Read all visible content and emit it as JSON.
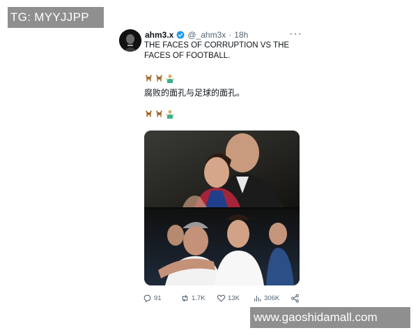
{
  "watermark_top": "TG: MYYJJPP",
  "watermark_bottom": "www.gaoshidamall.com",
  "tweet": {
    "display_name": "ahm3.x",
    "handle": "@_ahm3x",
    "separator": "·",
    "time": "18h",
    "text_en": "THE FACES OF CORRUPTION VS THE FACES OF FOOTBALL.",
    "text_zh": "腐败的面孔与足球的面孔。",
    "emoji_icons": [
      "goat-icon",
      "goat-icon",
      "person-shrugging-icon"
    ],
    "more_label": "···",
    "stats": {
      "replies": "91",
      "reposts": "1.7K",
      "likes": "13K",
      "views": "306K"
    },
    "colors": {
      "verified": "#1d9bf0",
      "text": "#0f1419",
      "muted": "#536471"
    }
  }
}
